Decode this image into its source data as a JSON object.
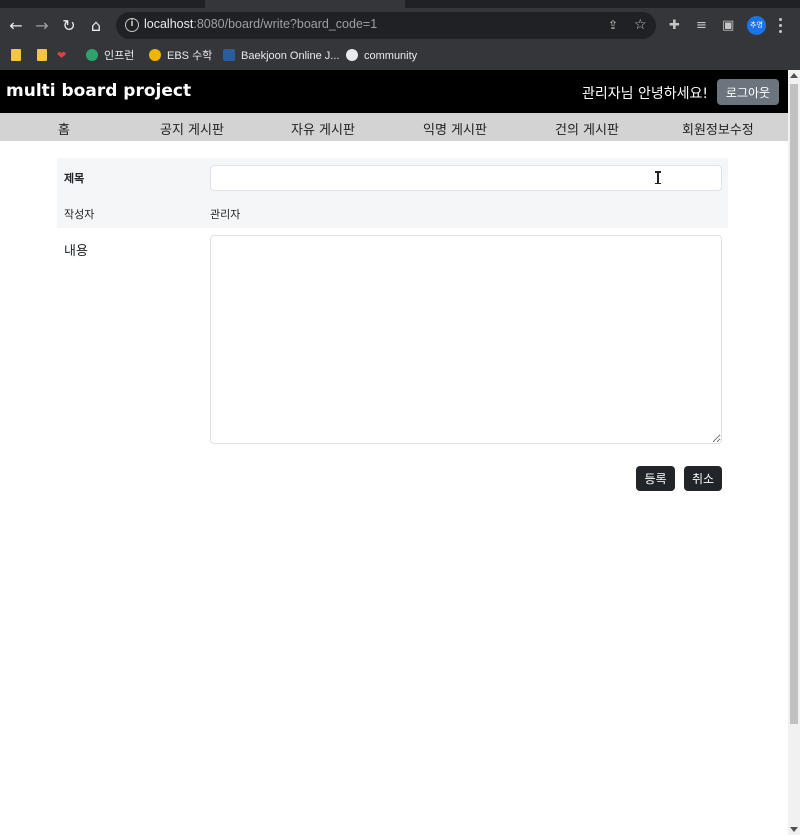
{
  "browser": {
    "url_host": "localhost",
    "url_rest": ":8080/board/write?board_code=1",
    "profile_initials": "추영",
    "bookmarks": [
      {
        "label": ""
      },
      {
        "label": ""
      },
      {
        "label": ""
      },
      {
        "label": "인프런",
        "icon": "inflearn-icon"
      },
      {
        "label": "EBS 수학",
        "icon": "ebs-icon"
      },
      {
        "label": "Baekjoon Online J...",
        "icon": "baekjoon-icon"
      },
      {
        "label": "community",
        "icon": "globe-icon"
      }
    ]
  },
  "header": {
    "site_title": "multi board project",
    "greeting": "관리자님 안녕하세요!",
    "logout_label": "로그아웃"
  },
  "menu": {
    "items": [
      {
        "label": "홈"
      },
      {
        "label": "공지 게시판"
      },
      {
        "label": "자유 게시판"
      },
      {
        "label": "익명 게시판"
      },
      {
        "label": "건의 게시판"
      },
      {
        "label": "회원정보수정"
      }
    ]
  },
  "form": {
    "title_label": "제목",
    "title_value": "",
    "writer_label": "작성자",
    "writer_value": "관리자",
    "content_label": "내용",
    "content_value": "",
    "submit_label": "등록",
    "cancel_label": "취소"
  }
}
